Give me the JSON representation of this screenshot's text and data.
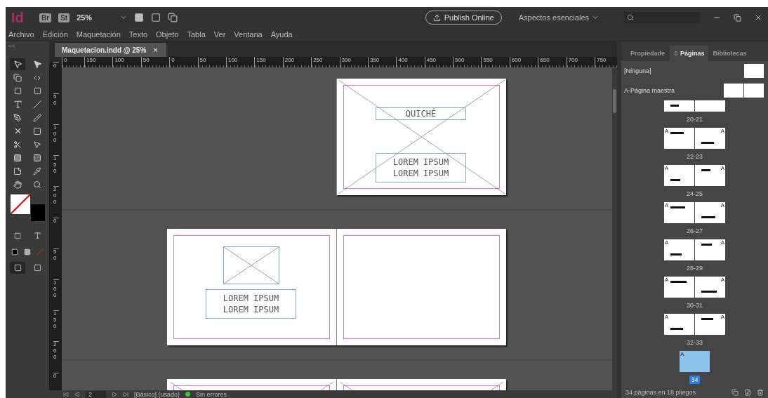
{
  "app_bar": {
    "logo": "Id",
    "bridge": "Br",
    "stock": "St",
    "zoom": "25%",
    "publish_button": "Publish Online",
    "workspace": "Aspectos esenciales"
  },
  "menu": [
    "Archivo",
    "Edición",
    "Maquetación",
    "Texto",
    "Objeto",
    "Tabla",
    "Ver",
    "Ventana",
    "Ayuda"
  ],
  "collapse_label": "<<",
  "document_tab": {
    "title": "Maquetacion.indd @ 25%",
    "close": "×"
  },
  "ruler": {
    "horizontal": [
      "0",
      "150",
      "100",
      "50",
      "0",
      "50",
      "100",
      "150",
      "200",
      "250",
      "300",
      "350",
      "400",
      "450",
      "500",
      "550",
      "600",
      "650",
      "700",
      "750"
    ],
    "vertical": [
      "0",
      "50",
      "100",
      "150",
      "200",
      "0",
      "50",
      "100",
      "150",
      "200",
      "0"
    ]
  },
  "spreads": [
    {
      "pages": [
        {
          "kind": "empty"
        },
        {
          "kind": "cover",
          "title": "QUICHÉ",
          "lines": [
            "LOREM IPSUM",
            "LOREM IPSUM"
          ]
        }
      ]
    },
    {
      "pages": [
        {
          "kind": "figure",
          "lines": [
            "LOREM IPSUM",
            "LOREM IPSUM"
          ]
        },
        {
          "kind": "blank"
        }
      ]
    },
    {
      "pages": [
        {
          "kind": "cross"
        },
        {
          "kind": "cross"
        }
      ]
    }
  ],
  "pages_panel": {
    "tabs": [
      {
        "label": "Propiedade",
        "selected": false
      },
      {
        "label": "Páginas",
        "selected": true
      },
      {
        "label": "Bibliotecas",
        "selected": false
      }
    ],
    "masters": [
      {
        "label": "[Ninguna]",
        "spread": false
      },
      {
        "label": "A-Página maestra",
        "spread": true
      }
    ],
    "spreads": [
      {
        "label": "20-21",
        "selected": false
      },
      {
        "label": "22-23",
        "marks": [
          "A",
          "A"
        ],
        "selected": false
      },
      {
        "label": "24-25",
        "marks": [
          "A",
          "A"
        ],
        "selected": false
      },
      {
        "label": "26-27",
        "marks": [
          "A",
          "A"
        ],
        "selected": false
      },
      {
        "label": "28-29",
        "marks": [
          "A",
          "A"
        ],
        "selected": false
      },
      {
        "label": "30-31",
        "marks": [
          "A",
          "A"
        ],
        "selected": false
      },
      {
        "label": "32-33",
        "marks": [
          "A",
          "A"
        ],
        "selected": false
      },
      {
        "label": "34",
        "marks": [
          "A"
        ],
        "selected": true
      }
    ],
    "footer": "34 páginas en 18 pliegos"
  },
  "status_bar": {
    "page": "2",
    "style": "[Básico] (usado)",
    "preflight": "Sin errores"
  }
}
